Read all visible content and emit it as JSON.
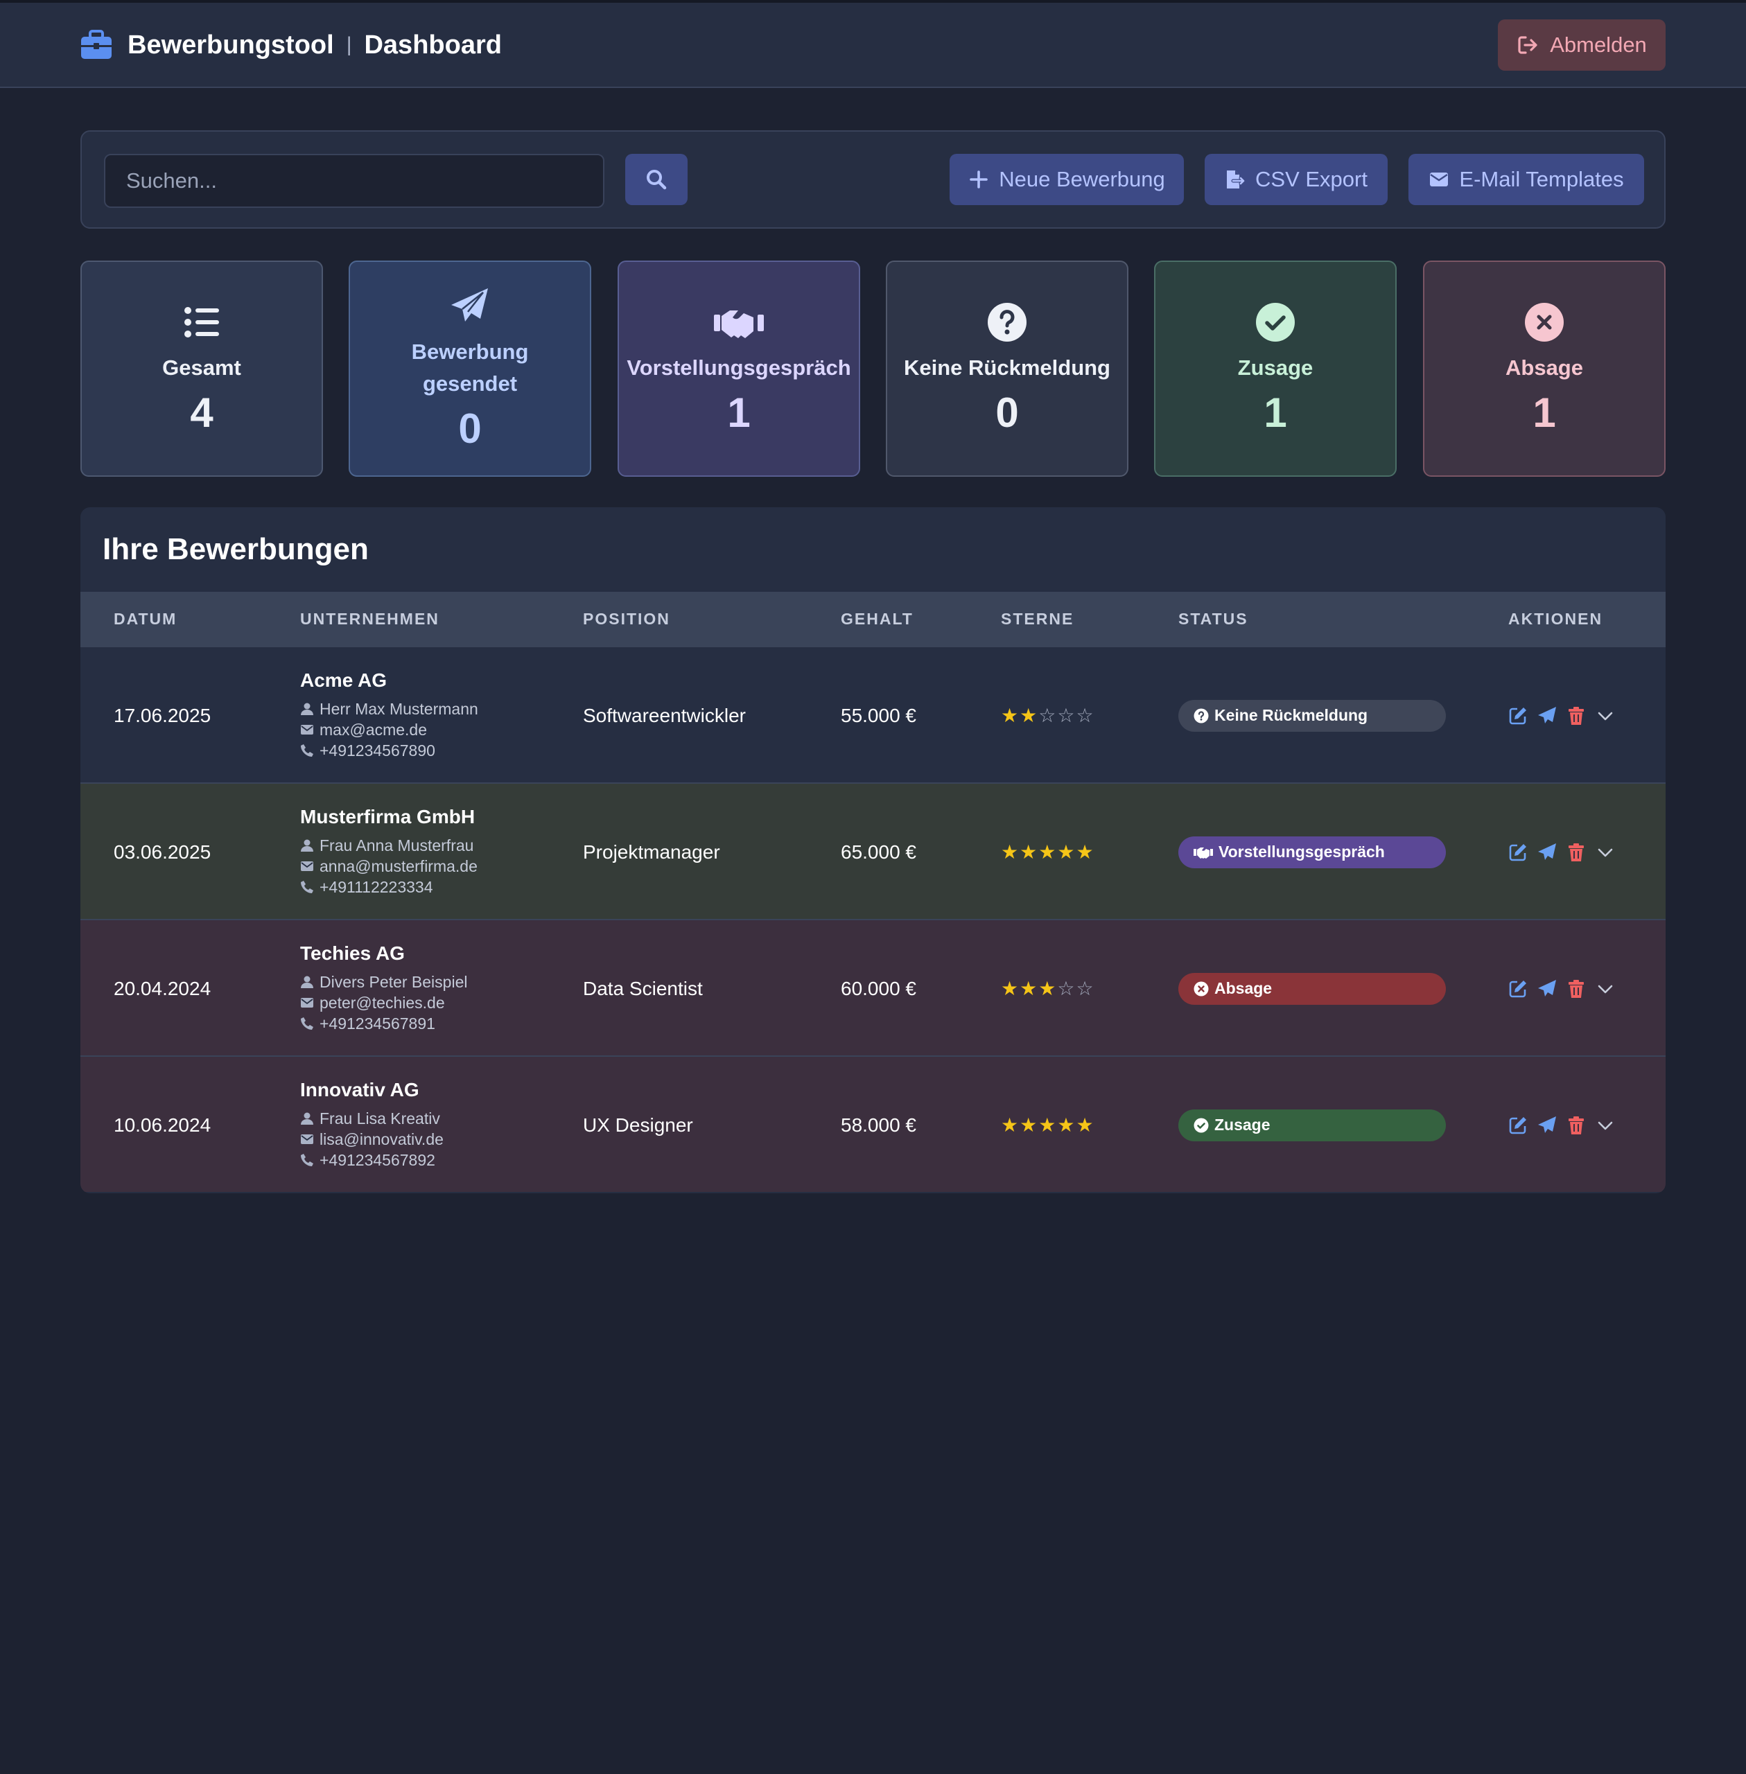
{
  "header": {
    "app_title": "Bewerbungstool",
    "separator": "|",
    "page_title": "Dashboard",
    "logout_label": "Abmelden"
  },
  "toolbar": {
    "search_placeholder": "Suchen...",
    "new_label": "Neue Bewerbung",
    "csv_label": "CSV Export",
    "mail_label": "E-Mail Templates"
  },
  "stats": [
    {
      "label": "Gesamt",
      "value": "4",
      "icon": "list-icon"
    },
    {
      "label": "Bewerbung gesendet",
      "value": "0",
      "icon": "paper-plane-icon"
    },
    {
      "label": "Vorstellungsgespräch",
      "value": "1",
      "icon": "handshake-icon"
    },
    {
      "label": "Keine Rückmeldung",
      "value": "0",
      "icon": "question-circle-icon"
    },
    {
      "label": "Zusage",
      "value": "1",
      "icon": "check-circle-icon"
    },
    {
      "label": "Absage",
      "value": "1",
      "icon": "x-circle-icon"
    }
  ],
  "table": {
    "title": "Ihre Bewerbungen",
    "columns": [
      "DATUM",
      "UNTERNEHMEN",
      "POSITION",
      "GEHALT",
      "STERNE",
      "STATUS",
      "AKTIONEN"
    ],
    "rows": [
      {
        "date": "17.06.2025",
        "company": "Acme AG",
        "contact": "Herr Max Mustermann",
        "email": "max@acme.de",
        "phone": "+491234567890",
        "position": "Softwareentwickler",
        "salary": "55.000 €",
        "stars": 2,
        "status": "Keine Rückmeldung",
        "row_color": "#262e42"
      },
      {
        "date": "03.06.2025",
        "company": "Musterfirma GmbH",
        "contact": "Frau Anna Musterfrau",
        "email": "anna@musterfirma.de",
        "phone": "+491112223334",
        "position": "Projektmanager",
        "salary": "65.000 €",
        "stars": 5,
        "status": "Vorstellungsgespräch",
        "row_color": "#353c38"
      },
      {
        "date": "20.04.2024",
        "company": "Techies AG",
        "contact": "Divers Peter Beispiel",
        "email": "peter@techies.de",
        "phone": "+491234567891",
        "position": "Data Scientist",
        "salary": "60.000 €",
        "stars": 3,
        "status": "Absage",
        "row_color": "#3c2f3e"
      },
      {
        "date": "10.06.2024",
        "company": "Innovativ AG",
        "contact": "Frau Lisa Kreativ",
        "email": "lisa@innovativ.de",
        "phone": "+491234567892",
        "position": "UX Designer",
        "salary": "58.000 €",
        "stars": 5,
        "status": "Zusage",
        "row_color": "#3c2f3e"
      }
    ]
  },
  "colors": {
    "background": "#1d2231",
    "panel": "#262e42",
    "accent": "#3d4a86",
    "logout": "#5a3a44",
    "star": "#f5c518"
  }
}
